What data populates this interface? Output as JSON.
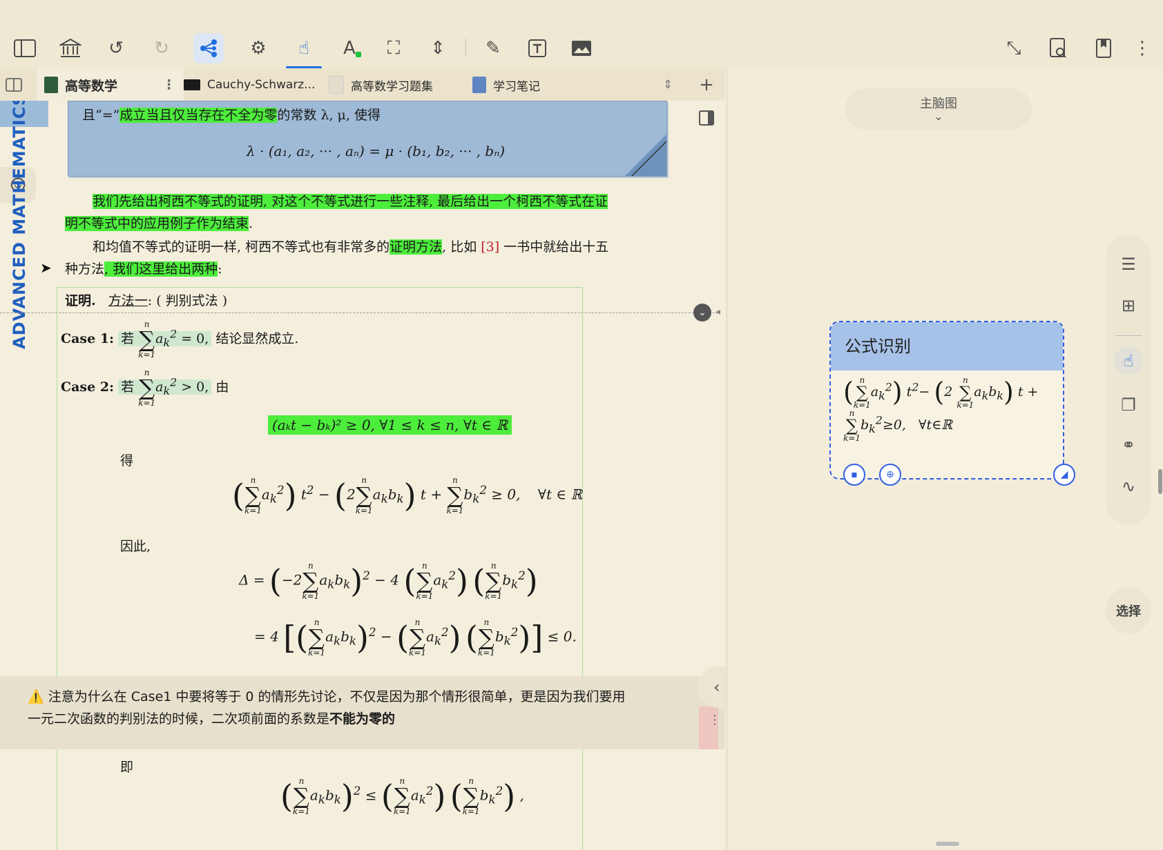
{
  "tabs": [
    {
      "label": "高等数学",
      "active": true,
      "color": "#2e5d3a"
    },
    {
      "label": "Cauchy-Schwarz...",
      "active": false,
      "color": "#1b1b1b"
    },
    {
      "label": "高等数学习题集",
      "active": false,
      "color": "#d9d2c0"
    },
    {
      "label": "学习笔记",
      "active": false,
      "color": "#5f86c2"
    }
  ],
  "toolbar_icons": [
    "sidebar-toggle-icon",
    "library-icon",
    "undo-icon",
    "redo-icon",
    "mindmap-share-icon",
    "settings-gear-icon",
    "pointer-hand-icon",
    "text-color-icon",
    "crop-frame-icon",
    "resize-icon",
    "pencil-icon",
    "text-box-icon",
    "image-icon",
    "collapse-icon",
    "search-document-icon",
    "bookmark-icon",
    "more-menu-icon"
  ],
  "doc": {
    "vertical_banner": "ADVANCED MATHEMATICS",
    "bluebox_line1_pre": "且“=”",
    "bluebox_line1_hl": "成立当且仅当存在不全为零",
    "bluebox_line1_post": "的常数 λ, μ, 使得",
    "bluebox_formula": "λ · (a₁, a₂, ··· , aₙ) = μ · (b₁, b₂, ··· , bₙ)",
    "para1_hl": "我们先给出柯西不等式的证明, 对这个不等式进行一些注释, 最后给出一个柯西不等式在证",
    "para1_hl2": "明不等式中的应用例子作为结束",
    "para1_end": ".",
    "para2_a": "和均值不等式的证明一样, 柯西不等式也有非常多的",
    "para2_hl": "证明方法",
    "para2_b": ", 比如 ",
    "para2_ref": "[3]",
    "para2_c": " 一书中就给出十五",
    "para3_a": "种方法",
    "para3_hl": ", 我们这里给出两种",
    "para3_b": ":",
    "proof_label": "证明.",
    "proof_method": "方法一",
    "proof_method_rest": ": ( 判别式法 )",
    "case1_label": "Case 1:",
    "case1_if": "若",
    "case1_cond": "= 0,",
    "case1_text": "结论显然成立.",
    "case2_label": "Case 2:",
    "case2_if": "若",
    "case2_cond": "> 0,",
    "case2_text": "由",
    "eq_green": "(aₖt − bₖ)² ≥ 0,    ∀1 ≤ k ≤ n,    ∀t ∈ ℝ",
    "de": "得",
    "yinci": "因此,",
    "ji": "即",
    "banner_icon": "⚠️",
    "banner_text1": "注意为什么在 Case1 中要将等于 0 的情形先讨论，不仅是因为那个情形很简单，更是因为我们要用",
    "banner_text2": "一元二次函数的判别法的时候，二次项前面的系数是",
    "banner_bold": "不能为零的"
  },
  "right": {
    "mindmap_label": "主脑图",
    "card_title": "公式识别",
    "select_label": "选择"
  }
}
